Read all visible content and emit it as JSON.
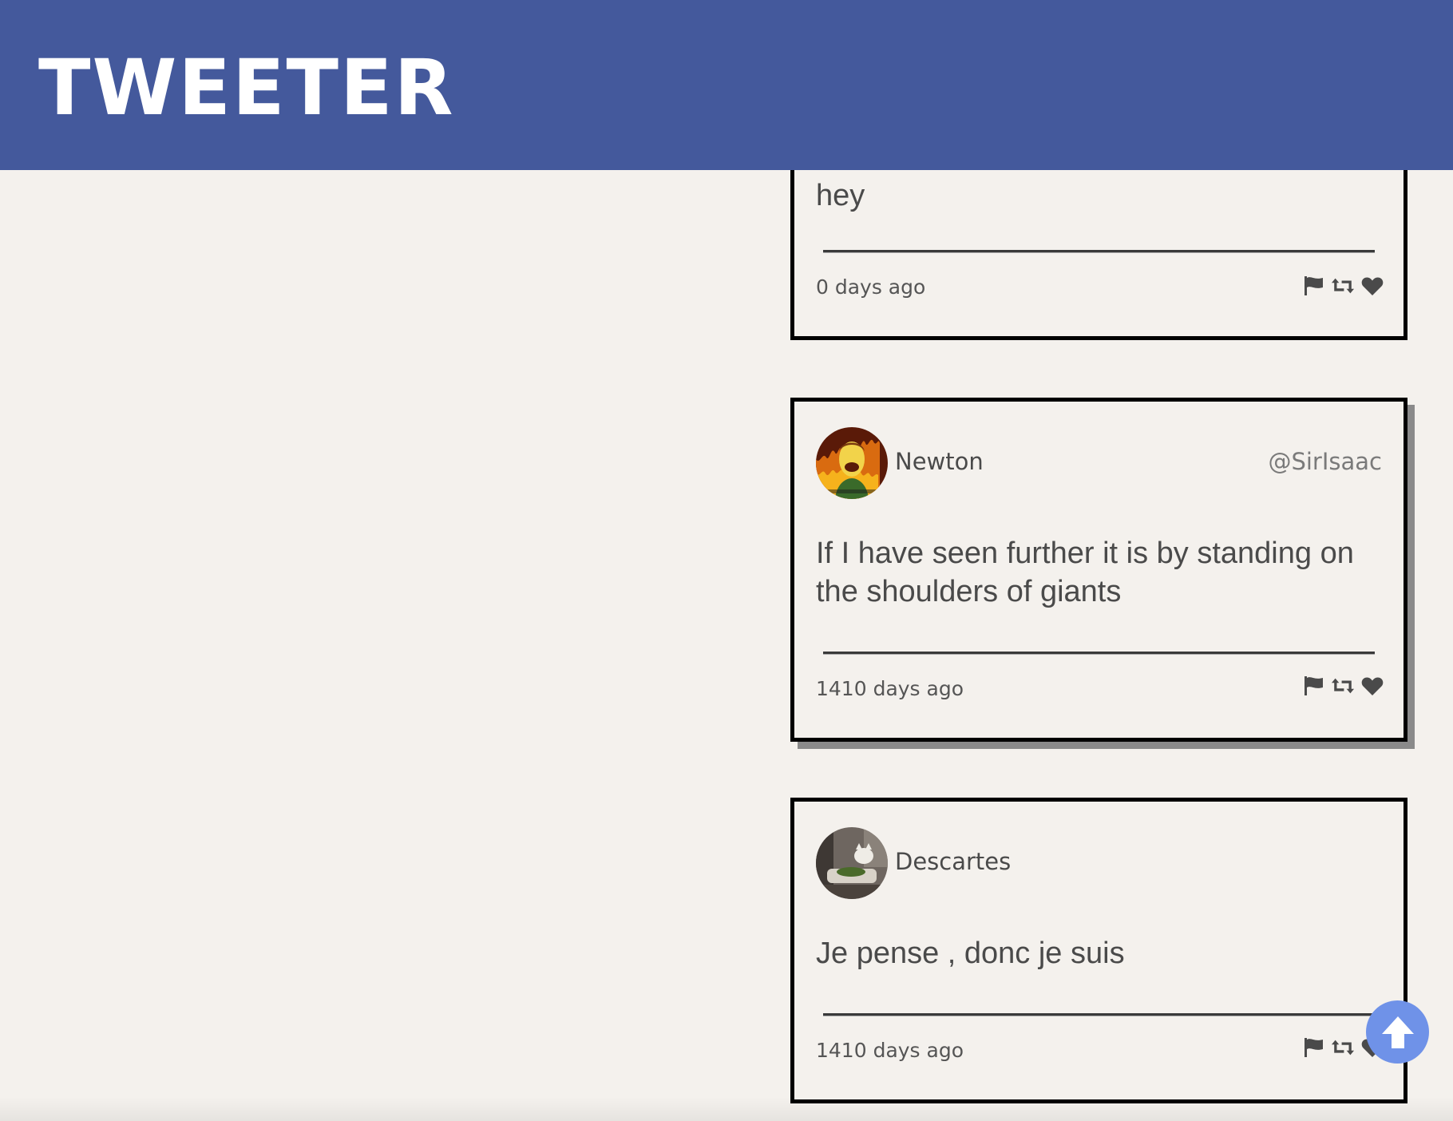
{
  "header": {
    "logo_text": "TWEETER"
  },
  "tweets": [
    {
      "name": "",
      "handle": "",
      "text": "hey",
      "time": "0 days ago",
      "actions": [
        "flag-icon",
        "retweet-icon",
        "heart-icon"
      ]
    },
    {
      "name": "Newton",
      "handle": "@SirIsaac",
      "text": "If I have seen further it is by standing on the shoulders of giants",
      "time": "1410 days ago",
      "actions": [
        "flag-icon",
        "retweet-icon",
        "heart-icon"
      ]
    },
    {
      "name": "Descartes",
      "handle": "",
      "text": "Je pense , donc je suis",
      "time": "1410 days ago",
      "actions": [
        "flag-icon",
        "retweet-icon",
        "heart-icon"
      ]
    }
  ],
  "scroll_top": {
    "icon": "arrow-up-icon"
  },
  "colors": {
    "header_bg": "#44599c",
    "page_bg": "#f4f1ed",
    "scroll_button": "#6f92e8"
  }
}
